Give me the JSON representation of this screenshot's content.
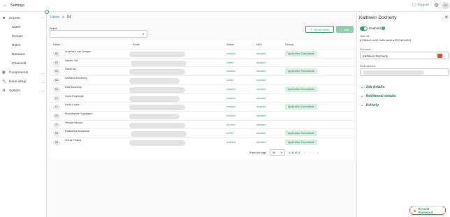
{
  "topbar": {
    "title": "Settings",
    "support_label": "Support",
    "avatar_initials": "KD"
  },
  "sidebar": {
    "items": [
      {
        "label": "Access",
        "icon": "people-icon"
      },
      {
        "label": "Users"
      },
      {
        "label": "Groups"
      },
      {
        "label": "Roles"
      },
      {
        "label": "Domains"
      },
      {
        "label": "Channels"
      },
      {
        "label": "Components",
        "icon": "components-icon"
      },
      {
        "label": "Issue setup",
        "icon": "wrench-icon"
      },
      {
        "label": "System",
        "icon": "gear-icon"
      }
    ]
  },
  "breadcrumb": {
    "link": "Users",
    "current": "54"
  },
  "search": {
    "label": "Search",
    "placeholder": ""
  },
  "toolbar": {
    "import_label": "Import users",
    "add_label": "Add"
  },
  "table": {
    "headers": [
      "Name",
      "Email",
      "Status",
      "MFA",
      "Groups"
    ],
    "rows": [
      {
        "initials": "AD",
        "name": "Aurelians van Dongen",
        "status": "enabled",
        "mfa": "disabled",
        "group": "Application Consultants"
      },
      {
        "initials": "HT",
        "name": "Hanek Tnit",
        "status": "invited",
        "mfa": "disabled",
        "group": ""
      },
      {
        "initials": "HA",
        "name": "Hanét Au",
        "status": "enabled",
        "mfa": "disabled",
        "group": "Application Consultants"
      },
      {
        "initials": "KD",
        "name": "Kathleen Docherty",
        "status": "invited",
        "mfa": "disabled",
        "group": ""
      },
      {
        "initials": "KD",
        "name": "Kate Docherty",
        "status": "enabled",
        "mfa": "disabled",
        "group": "Application Consultants"
      },
      {
        "initials": "LE",
        "name": "Lucia Employee",
        "status": "enabled",
        "mfa": "disabled",
        "group": ""
      },
      {
        "initials": "LL",
        "name": "Lucia Lopez",
        "status": "enabled",
        "mfa": "disabled",
        "group": "Application Consultants"
      },
      {
        "initials": "MG",
        "name": "Motsotapele Guadagno",
        "status": "enabled",
        "mfa": "disabled",
        "group": ""
      },
      {
        "initials": "PI",
        "name": "People Intouch",
        "status": "disabled",
        "mfa": "disabled",
        "group": ""
      },
      {
        "initials": "RA",
        "name": "Radostina Atobuowa",
        "status": "invited",
        "mfa": "disabled",
        "group": "Application Consultants"
      },
      {
        "initials": "ST",
        "name": "Shiraz Thakur",
        "status": "enabled",
        "mfa": "disabled",
        "group": "Application Consultants"
      }
    ]
  },
  "pager": {
    "rows_label": "Rows per page",
    "rows_value": "50",
    "range": "1–11 of 11"
  },
  "panel": {
    "title": "Kathleen Docherty",
    "enabled_label": "Enabled",
    "user_id_label": "User ID",
    "user_id_value": "67980lc0-4c32-4a0b-a8df-a3297d634291",
    "full_name_label": "Full name*",
    "full_name_value": "Kathleen Docherty",
    "email_label": "Email address*",
    "sections": [
      "Job details",
      "Additional details",
      "Activity"
    ],
    "resend_label": "Resend Password"
  },
  "colors": {
    "accent": "#2f9e6b",
    "link": "#2f7ed8",
    "group_bg": "#d8f0e2",
    "highlight": "#e04030"
  }
}
